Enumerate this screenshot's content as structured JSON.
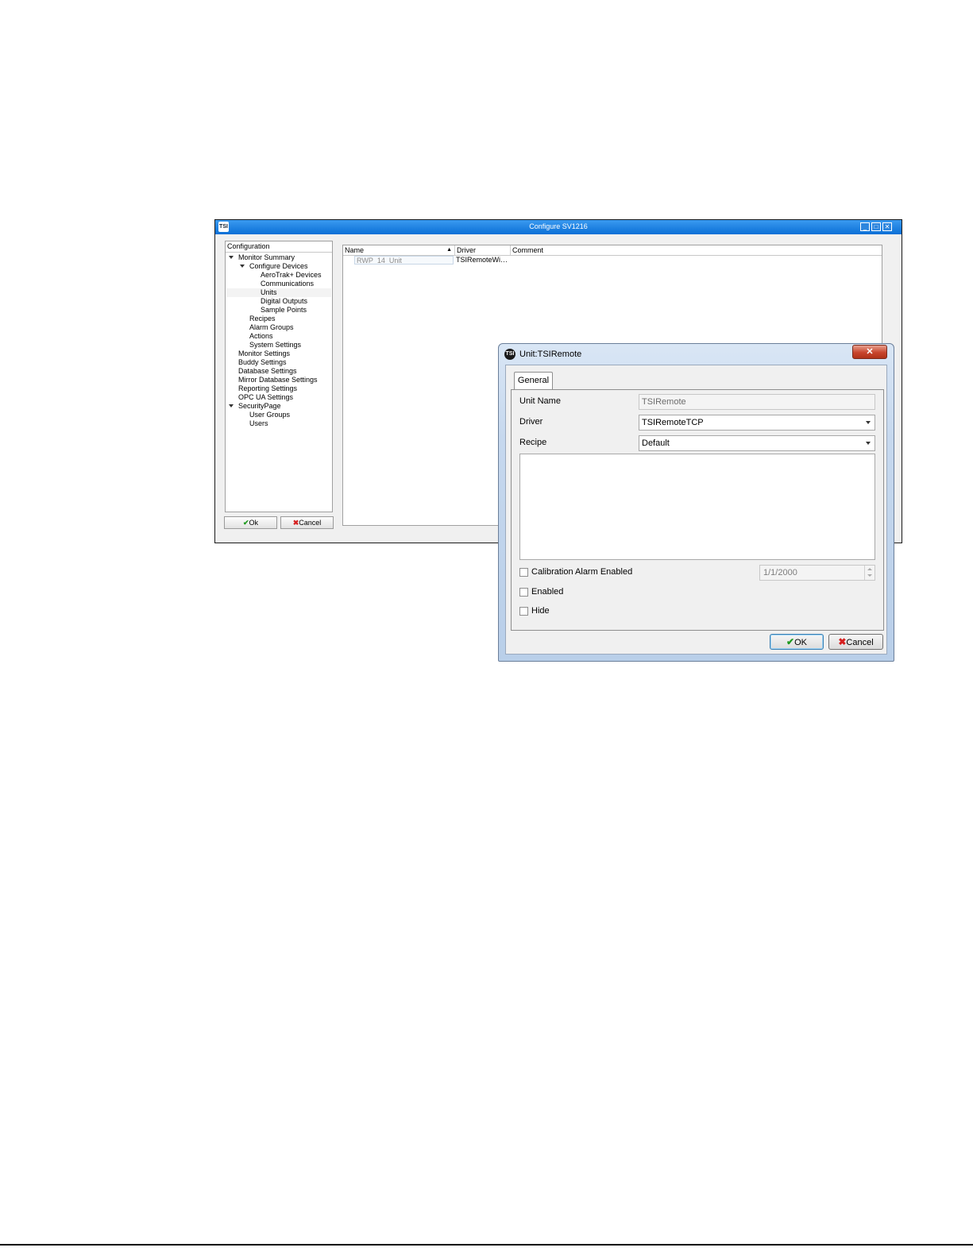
{
  "main_window": {
    "title": "Configure SV1216",
    "logo_text": "TSI",
    "controls": {
      "minimize": "_",
      "maximize": "□",
      "close": "✕"
    },
    "tree": {
      "header": "Configuration",
      "items": [
        {
          "label": "Monitor Summary",
          "expanded": true
        },
        {
          "label": "Configure Devices",
          "expanded": true
        },
        {
          "label": "AeroTrak+ Devices"
        },
        {
          "label": "Communications"
        },
        {
          "label": "Units",
          "selected": true
        },
        {
          "label": "Digital Outputs"
        },
        {
          "label": "Sample Points"
        },
        {
          "label": "Recipes"
        },
        {
          "label": "Alarm Groups"
        },
        {
          "label": "Actions"
        },
        {
          "label": "System Settings"
        },
        {
          "label": "Monitor Settings"
        },
        {
          "label": "Buddy Settings"
        },
        {
          "label": "Database Settings"
        },
        {
          "label": "Mirror Database Settings"
        },
        {
          "label": "Reporting Settings"
        },
        {
          "label": "OPC UA Settings"
        },
        {
          "label": "SecurityPage",
          "expanded": true
        },
        {
          "label": "User Groups"
        },
        {
          "label": "Users"
        }
      ]
    },
    "ok_label": "Ok",
    "cancel_label": "Cancel",
    "grid": {
      "columns": [
        "Name",
        "Driver",
        "Comment"
      ],
      "rows": [
        {
          "name": "RWP_14_Unit",
          "driver": "TSIRemoteWi…",
          "comment": ""
        }
      ]
    }
  },
  "dialog": {
    "title": "Unit:TSIRemote",
    "logo_text": "TSI",
    "close_glyph": "✕",
    "tab": "General",
    "unit_name_label": "Unit Name",
    "unit_name_value": "TSIRemote",
    "driver_label": "Driver",
    "driver_value": "TSIRemoteTCP",
    "recipe_label": "Recipe",
    "recipe_value": "Default",
    "calibration_label": "Calibration Alarm Enabled",
    "calibration_checked": false,
    "calibration_date": "1/1/2000",
    "enabled_label": "Enabled",
    "enabled_checked": false,
    "hide_label": "Hide",
    "hide_checked": false,
    "ok_label": "OK",
    "cancel_label": "Cancel"
  }
}
